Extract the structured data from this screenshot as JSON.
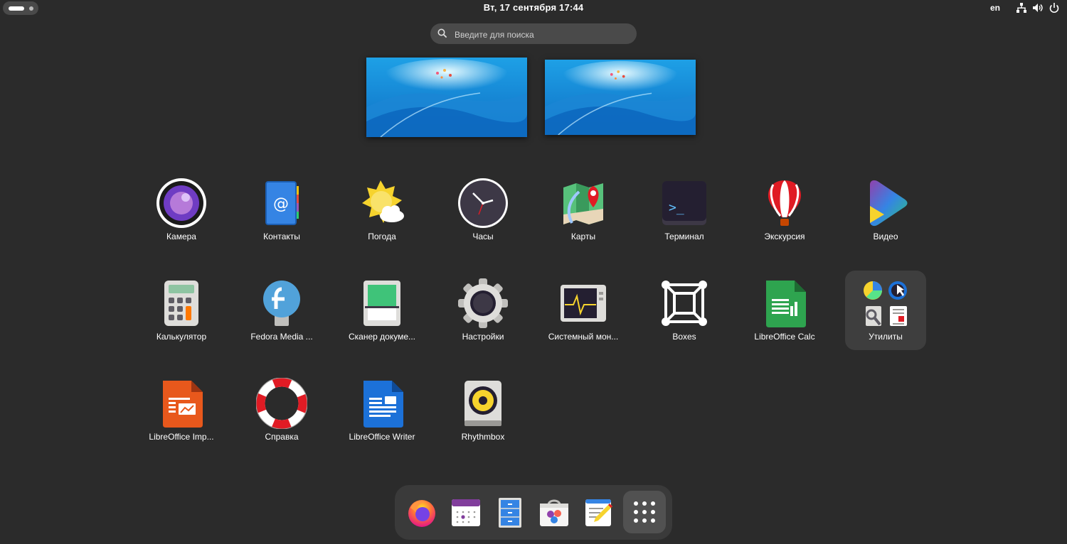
{
  "topbar": {
    "clock": "Вт, 17 сентября  17:44",
    "language": "en",
    "icons": [
      "network-icon",
      "volume-icon",
      "power-icon"
    ]
  },
  "search": {
    "placeholder": "Введите для поиска",
    "value": ""
  },
  "apps": [
    {
      "label": "Камера",
      "icon": "camera-icon"
    },
    {
      "label": "Контакты",
      "icon": "contacts-icon"
    },
    {
      "label": "Погода",
      "icon": "weather-icon"
    },
    {
      "label": "Часы",
      "icon": "clock-icon"
    },
    {
      "label": "Карты",
      "icon": "maps-icon"
    },
    {
      "label": "Терминал",
      "icon": "terminal-icon"
    },
    {
      "label": "Экскурсия",
      "icon": "tour-balloon-icon"
    },
    {
      "label": "Видео",
      "icon": "video-icon"
    },
    {
      "label": "Калькулятор",
      "icon": "calculator-icon"
    },
    {
      "label": "Fedora Media ...",
      "icon": "fedora-media-writer-icon"
    },
    {
      "label": "Сканер докуме...",
      "icon": "document-scanner-icon"
    },
    {
      "label": "Настройки",
      "icon": "settings-gear-icon"
    },
    {
      "label": "Системный мон...",
      "icon": "system-monitor-icon"
    },
    {
      "label": "Boxes",
      "icon": "boxes-icon"
    },
    {
      "label": "LibreOffice Calc",
      "icon": "libreoffice-calc-icon"
    },
    {
      "label": "Утилиты",
      "icon": "utilities-folder-icon"
    },
    {
      "label": "LibreOffice Imp...",
      "icon": "libreoffice-impress-icon"
    },
    {
      "label": "Справка",
      "icon": "help-lifebuoy-icon"
    },
    {
      "label": "LibreOffice Writer",
      "icon": "libreoffice-writer-icon"
    },
    {
      "label": "Rhythmbox",
      "icon": "rhythmbox-icon"
    }
  ],
  "dash": [
    "firefox-icon",
    "calendar-icon",
    "files-icon",
    "software-icon",
    "text-editor-icon",
    "app-grid-icon"
  ],
  "colors": {
    "background": "#2b2b2b",
    "panel": "#3a3a3a",
    "accent": "#3584e4"
  }
}
